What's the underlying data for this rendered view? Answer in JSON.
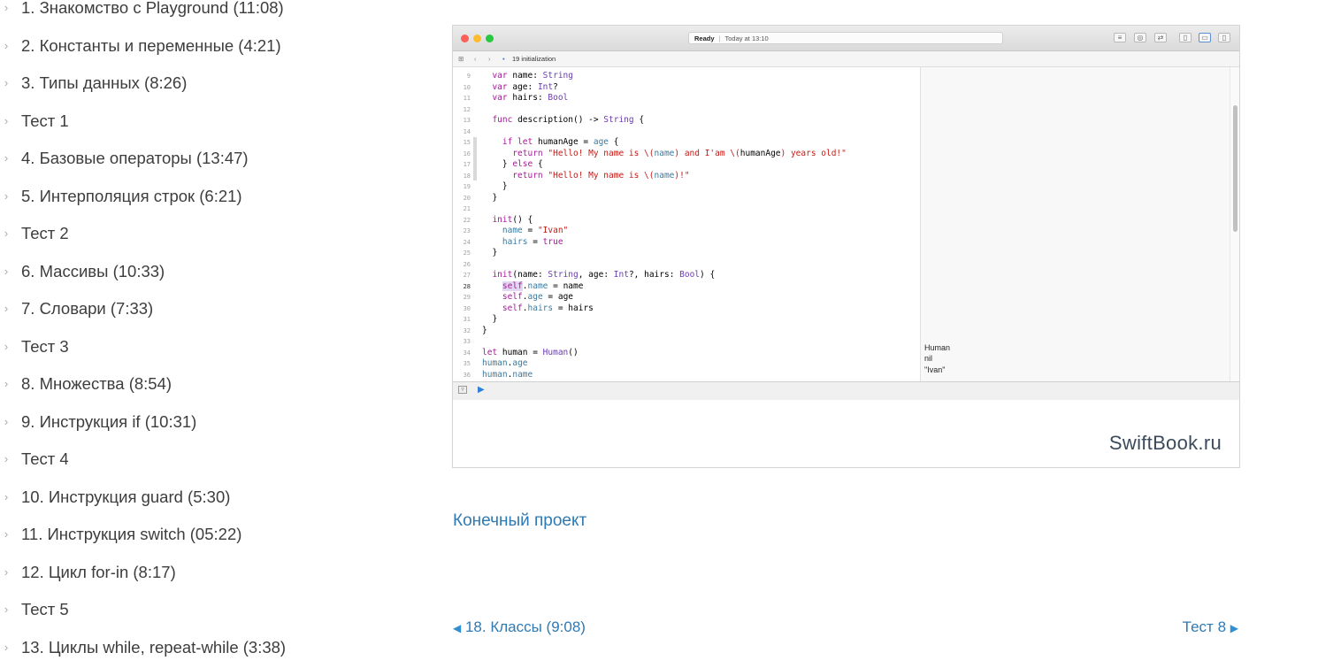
{
  "lessons": [
    "1. Знакомство с Playground (11:08)",
    "2. Константы и переменные (4:21)",
    "3. Типы данных (8:26)",
    "Тест 1",
    "4. Базовые операторы (13:47)",
    "5. Интерполяция строк (6:21)",
    "Тест 2",
    "6. Массивы (10:33)",
    "7. Словари (7:33)",
    "Тест 3",
    "8. Множества (8:54)",
    "9. Инструкция if (10:31)",
    "Тест 4",
    "10. Инструкция guard (5:30)",
    "11. Инструкция switch (05:22)",
    "12. Цикл for-in (8:17)",
    "Тест 5",
    "13. Циклы while, repeat-while (3:38)"
  ],
  "chevron_glyph": "›",
  "video": {
    "status_ready": "Ready",
    "status_sep": "|",
    "status_time": "Today at 13:10",
    "file_name": "19 initialization",
    "results": [
      "Human",
      "nil",
      "\"Ivan\""
    ],
    "watermark": "SwiftBook.ru",
    "line_numbers": [
      "9",
      "10",
      "11",
      "12",
      "13",
      "14",
      "15",
      "16",
      "17",
      "18",
      "19",
      "20",
      "21",
      "22",
      "23",
      "24",
      "25",
      "26",
      "27",
      "28",
      "29",
      "30",
      "31",
      "32",
      "33",
      "34",
      "35",
      "36"
    ]
  },
  "final_project_link": "Конечный проект",
  "nav": {
    "prev": "18. Классы (9:08)",
    "next": "Тест 8"
  },
  "colors": {
    "link": "#2f7ab3",
    "traffic_red": "#fc5f57",
    "traffic_yellow": "#fdbc2e",
    "traffic_green": "#28c840"
  }
}
